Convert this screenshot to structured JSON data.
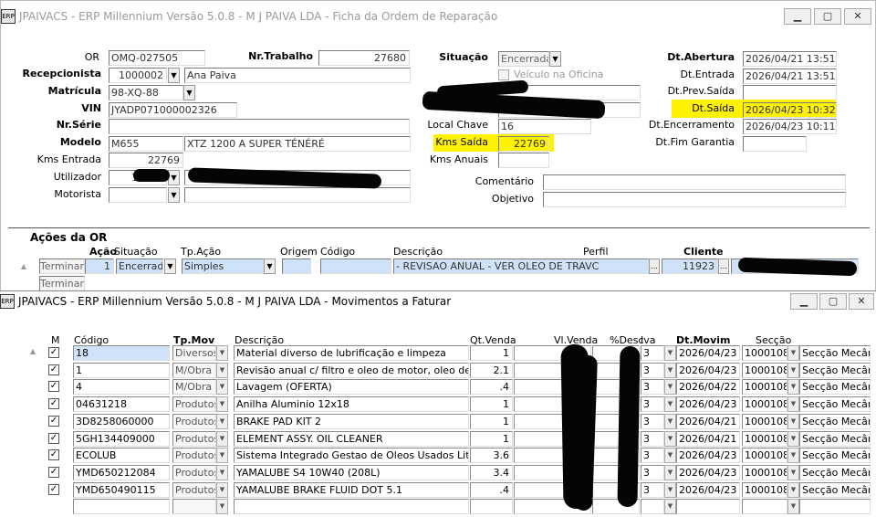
{
  "ficha": {
    "title": "JPAIVACS - ERP Millennium Versão 5.0.8 - M J PAIVA LDA - Ficha da Ordem de Reparação",
    "or_label": "OR",
    "or_value": "OMQ-027505",
    "nr_trabalho_label": "Nr.Trabalho",
    "nr_trabalho_value": "27680",
    "recepcionista_label": "Recepcionista",
    "recepcionista_code": "1000002",
    "recepcionista_name": "Ana Paiva",
    "matricula_label": "Matrícula",
    "matricula_value": "98-XQ-88",
    "vin_label": "VIN",
    "vin_value": "JYADP071000002326",
    "nr_serie_label": "Nr.Série",
    "modelo_label": "Modelo",
    "modelo_code": "M655",
    "modelo_desc": "XTZ 1200 A SUPER TÉNÉRÉ",
    "kms_entrada_label": "Kms Entrada",
    "kms_entrada_value": "22769",
    "utilizador_label": "Utilizador",
    "utilizador_code": "11923",
    "motorista_label": "Motorista",
    "situacao_label": "Situação",
    "situacao_value": "Encerrada",
    "veiculo_oficina_label": "Veículo na Oficina",
    "local_chave_label": "Local Chave",
    "local_chave_value": "16",
    "kms_saida_label": "Kms Saída",
    "kms_saida_value": "22769",
    "kms_anuais_label": "Kms Anuais",
    "comentario_label": "Comentário",
    "objetivo_label": "Objetivo",
    "dt_abertura_label": "Dt.Abertura",
    "dt_abertura_value": "2026/04/21 13:51",
    "dt_entrada_label": "Dt.Entrada",
    "dt_entrada_value": "2026/04/21 13:51",
    "dt_prev_saida_label": "Dt.Prev.Saída",
    "dt_saida_label": "Dt.Saída",
    "dt_saida_value": "2026/04/23 10:32",
    "dt_encerramento_label": "Dt.Encerramento",
    "dt_encerramento_value": "2026/04/23 10:11",
    "dt_fim_garantia_label": "Dt.Fim Garantia",
    "acoes_title": "Ações da OR",
    "acoes_cols": [
      "Ação",
      "Situação",
      "Tp.Ação",
      "Origem",
      "Código",
      "Descrição",
      "Perfil",
      "Cliente"
    ],
    "acao_row": {
      "terminar": "Terminar",
      "acao": "1",
      "situacao": "Encerrada",
      "tp_acao": "Simples",
      "descricao": "- REVISAO ANUAL - VER OLEO DE TRAVC",
      "cliente": "11923"
    },
    "acao_row2_terminar": "Terminar"
  },
  "movimentos": {
    "title": "JPAIVACS - ERP Millennium Versão 5.0.8 - M J PAIVA LDA - Movimentos a Faturar",
    "headers": {
      "m": "M",
      "codigo": "Código",
      "tp_mov": "Tp.Mov",
      "descricao": "Descrição",
      "qt_venda": "Qt.Venda",
      "vl_venda": "Vl.Venda",
      "desc_iva": "%Desc",
      "iva": "Iva",
      "dt_movim": "Dt.Movim",
      "seccao": "Secção"
    },
    "rows": [
      {
        "codigo": "18",
        "tp_mov": "Diversos",
        "descricao": "Material diverso de lubrificação e limpeza",
        "qt": "1",
        "iva": "3",
        "dt": "2026/04/23",
        "seccao_code": "1000108",
        "seccao": "Secção Mecân"
      },
      {
        "codigo": "1",
        "tp_mov": "M/Obra",
        "descricao": "Revisão anual c/ filtro e oleo de motor, oleo de travoe",
        "qt": "2.1",
        "iva": "3",
        "dt": "2026/04/23",
        "seccao_code": "1000108",
        "seccao": "Secção Mecân"
      },
      {
        "codigo": "4",
        "tp_mov": "M/Obra",
        "descricao": "Lavagem (OFERTA)",
        "qt": ".4",
        "iva": "3",
        "dt": "2026/04/22",
        "seccao_code": "1000108",
        "seccao": "Secção Mecân"
      },
      {
        "codigo": "04631218",
        "tp_mov": "Produtos",
        "descricao": "Anilha Aluminio 12x18",
        "qt": "1",
        "iva": "3",
        "dt": "2026/04/23",
        "seccao_code": "1000108",
        "seccao": "Secção Mecân"
      },
      {
        "codigo": "3D8258060000",
        "tp_mov": "Produtos",
        "descricao": "BRAKE PAD KIT 2",
        "qt": "1",
        "iva": "3",
        "dt": "2026/04/21",
        "seccao_code": "1000108",
        "seccao": "Secção Mecân"
      },
      {
        "codigo": "5GH134409000",
        "tp_mov": "Produtos",
        "descricao": "ELEMENT ASSY. OIL CLEANER",
        "qt": "1",
        "iva": "3",
        "dt": "2026/04/21",
        "seccao_code": "1000108",
        "seccao": "Secção Mecân"
      },
      {
        "codigo": "ECOLUB",
        "tp_mov": "Produtos",
        "descricao": "Sistema Integrado Gestao de Oleos Usados Litro",
        "qt": "3.6",
        "iva": "3",
        "dt": "2026/04/23",
        "seccao_code": "1000108",
        "seccao": "Secção Mecân"
      },
      {
        "codigo": "YMD650212084",
        "tp_mov": "Produtos",
        "descricao": "YAMALUBE S4 10W40 (208L)",
        "qt": "3.4",
        "iva": "3",
        "dt": "2026/04/23",
        "seccao_code": "1000108",
        "seccao": "Secção Mecân"
      },
      {
        "codigo": "YMD650490115",
        "tp_mov": "Produtos",
        "descricao": "YAMALUBE BRAKE FLUID DOT 5.1",
        "qt": ".4",
        "iva": "3",
        "dt": "2026/04/23",
        "seccao_code": "1000108",
        "seccao": "Secção Mecân"
      }
    ]
  }
}
